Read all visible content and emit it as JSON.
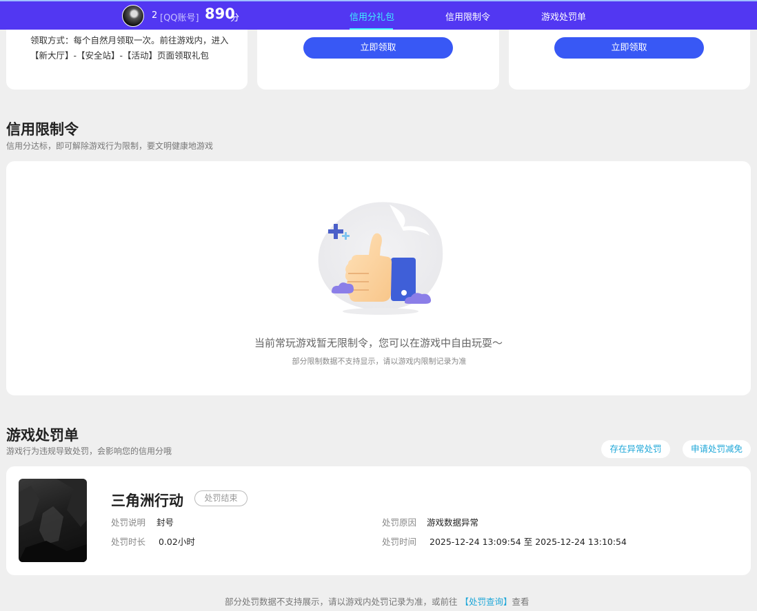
{
  "header": {
    "user_number": "2",
    "account_type": "[QQ账号]",
    "score": "890",
    "score_unit": "分",
    "tabs": [
      {
        "label": "信用分礼包",
        "active": true
      },
      {
        "label": "信用限制令",
        "active": false
      },
      {
        "label": "游戏处罚单",
        "active": false
      }
    ]
  },
  "gift_cards": {
    "claim_text": "领取方式：每个自然月领取一次。前往游戏内，进入【新大厅】-【安全站】-【活动】页面领取礼包",
    "claim_buttons": [
      "立即领取",
      "立即领取"
    ]
  },
  "restriction": {
    "title": "信用限制令",
    "subtitle": "信用分达标，即可解除游戏行为限制，要文明健康地游戏",
    "empty_main": "当前常玩游戏暂无限制令，您可以在游戏中自由玩耍～",
    "empty_sub": "部分限制数据不支持显示，请以游戏内限制记录为准"
  },
  "penalty": {
    "title": "游戏处罚单",
    "subtitle": "游戏行为违规导致处罚，会影响您的信用分哦",
    "btn_abnormal": "存在异常处罚",
    "btn_appeal": "申请处罚减免",
    "record": {
      "game": "三角洲行动",
      "status": "处罚结束",
      "desc_label": "处罚说明",
      "desc_value": "封号",
      "duration_label": "处罚时长",
      "duration_value": "0.02小时",
      "reason_label": "处罚原因",
      "reason_value": "游戏数据异常",
      "time_label": "处罚时间",
      "time_value": "2025-12-24 13:09:54 至 2025-12-24 13:10:54"
    }
  },
  "footer": {
    "text_before": "部分处罚数据不支持展示，请以游戏内处罚记录为准，或前往 ",
    "link": "【处罚查询】",
    "text_after": "查看"
  },
  "colors": {
    "header_bg": "#5237f2",
    "accent_tab": "#3ff0ff",
    "button_blue": "#3858f5",
    "link": "#1fa7d8"
  }
}
